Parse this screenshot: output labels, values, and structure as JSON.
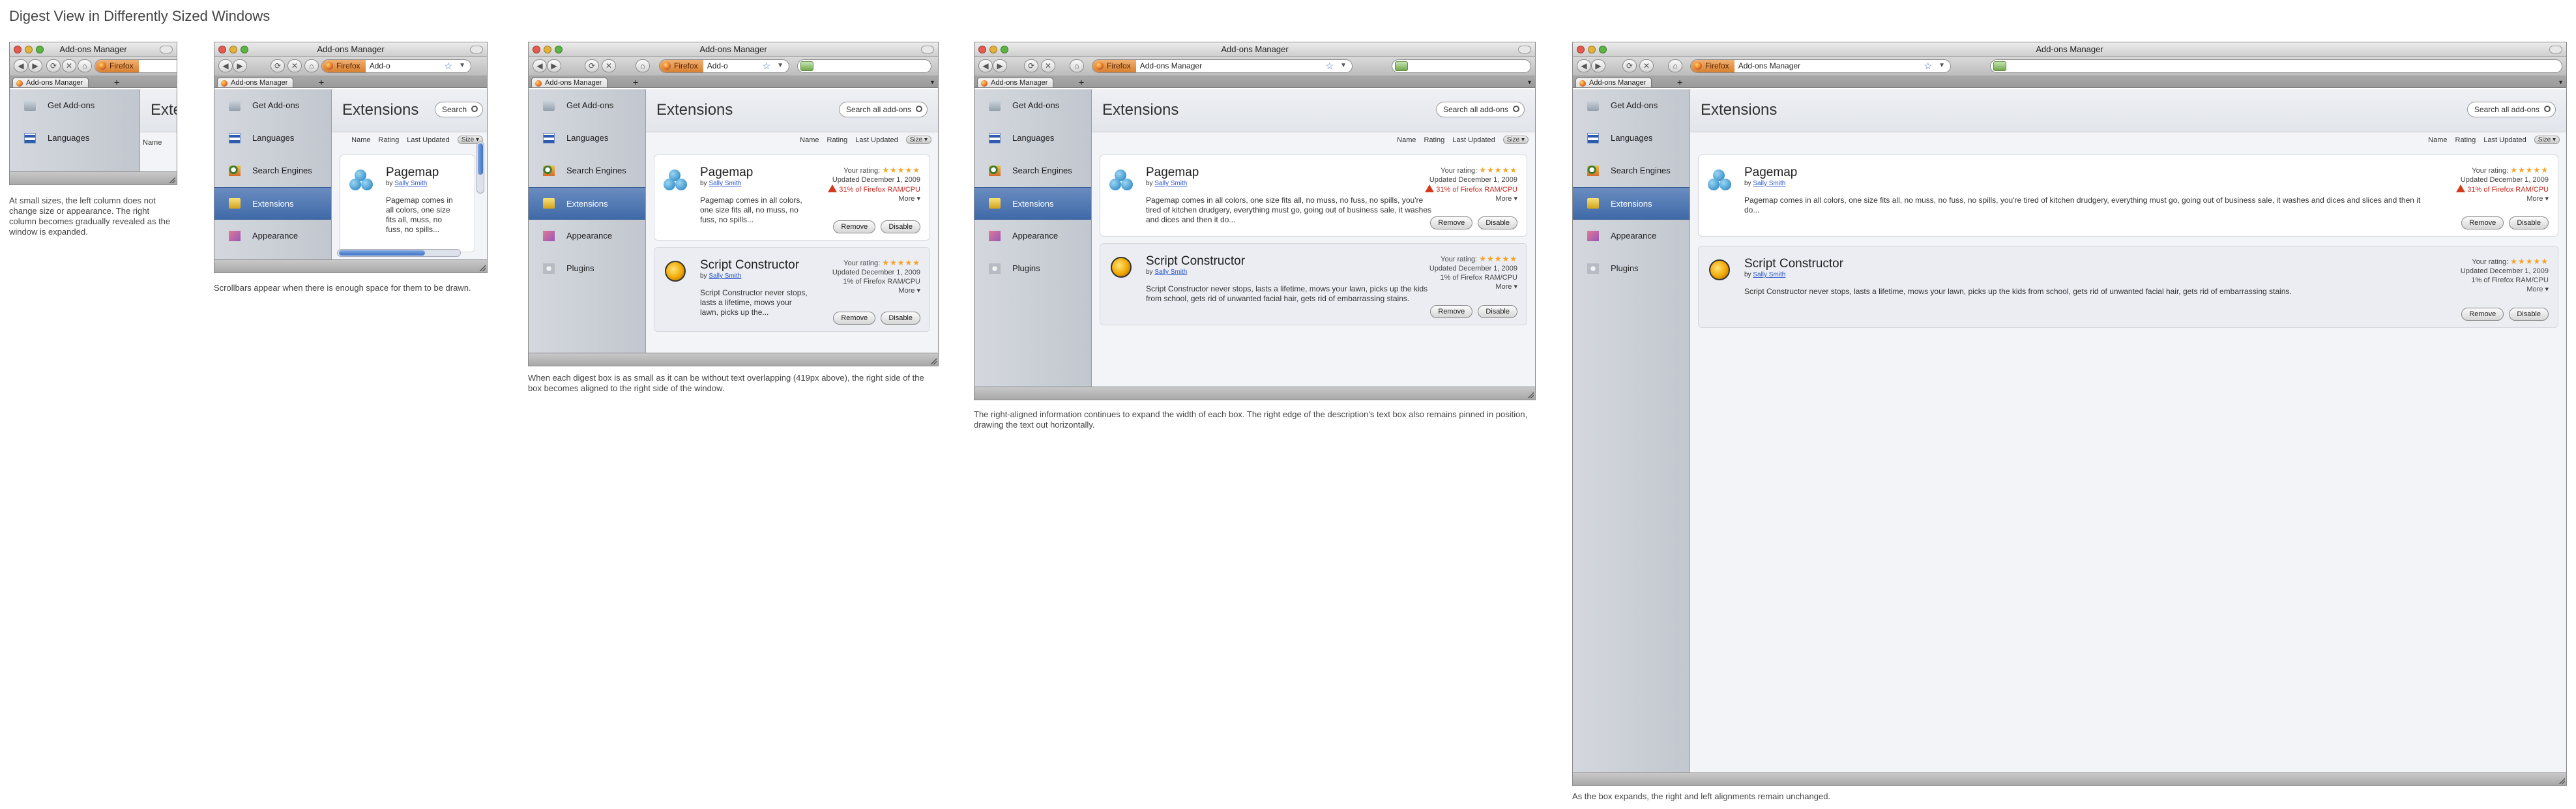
{
  "page_title": "Digest View in Differently Sized Windows",
  "window_title": "Add-ons Manager",
  "identity_label": "Firefox",
  "tab_label": "Add-ons Manager",
  "url_text": "Add-ons Manager",
  "url_text_short": "Add-o",
  "nav_glyphs": {
    "back": "◀",
    "forward": "▶",
    "reload": "⟳",
    "stop": "✕",
    "home": "⌂",
    "star": "☆",
    "dropdown": "▼",
    "newtab": "+",
    "tabmenu": "▼"
  },
  "categories": {
    "get": "Get Add-ons",
    "languages": "Languages",
    "search": "Search Engines",
    "extensions": "Extensions",
    "appearance": "Appearance",
    "plugins": "Plugins"
  },
  "header": {
    "title": "Extensions",
    "title_partial": "Exter",
    "search_placeholder": "Search all add-ons",
    "search_short": "Search"
  },
  "sort": {
    "name": "Name",
    "rating": "Rating",
    "last_updated": "Last Updated",
    "size": "Size ▾"
  },
  "tiny_sort": {
    "name": "Name"
  },
  "addons": [
    {
      "name": "Pagemap",
      "by": "by",
      "author": "Sally Smith",
      "desc": "Pagemap comes in all colors, one size fits all, no muss, no fuss, no spills, you're tired of kitchen drudgery, everything must go, going out of business sale, it washes and dices and slices and then it do...",
      "desc_mid": "Pagemap comes in all colors, one size fits all, no muss, no fuss, no spills, you're tired of kitchen drudgery, everything must go, going out of business sale, it washes and dices and then it do...",
      "desc_small": "Pagemap comes in all colors, one size fits all, no muss, no fuss, no spills...",
      "desc_tiny": "Pagemap comes in all colors, one size fits all, muss, no fuss, no spills...",
      "rating_label": "Your rating:",
      "stars": "★★★★★",
      "updated": "Updated December 1, 2009",
      "usage": "31% of Firefox RAM/CPU",
      "more": "More ▾",
      "remove": "Remove",
      "disable": "Disable"
    },
    {
      "name": "Script Constructor",
      "by": "by",
      "author": "Sally Smith",
      "desc": "Script Constructor never stops, lasts a lifetime, mows your lawn, picks up the kids from school, gets rid of unwanted facial hair, gets rid of embarrassing stains.",
      "desc_mid": "Script Constructor never stops, lasts a lifetime, mows your lawn, picks up the kids from school, gets rid of unwanted facial hair, gets rid of embarrassing stains.",
      "desc_small": "Script Constructor never stops, lasts a lifetime, mows your lawn, picks up the...",
      "rating_label": "Your rating:",
      "stars": "★★★★★",
      "updated": "Updated December 1, 2009",
      "usage": "1% of Firefox RAM/CPU",
      "more": "More ▾",
      "remove": "Remove",
      "disable": "Disable"
    }
  ],
  "captions": {
    "c1": "At small sizes, the left column does not change size or appearance.  The right column becomes gradually revealed as the window is expanded.",
    "c2": "Scrollbars appear when there is enough space for them to be drawn.",
    "c3": "When each digest box is as small as it can be without text overlapping (419px above), the right side of the box becomes aligned to the right side of the window.",
    "c4": "The right-aligned information continues to expand the width of each box.  The right edge of the description's text box also remains pinned in position, drawing the text out horizontally.",
    "c5": "As the box expands, the right and left alignments remain unchanged."
  },
  "colors": {
    "accent": "#3f6aa8",
    "warning": "#c0281e",
    "stars": "#f4a326",
    "link": "#2a55c8"
  }
}
